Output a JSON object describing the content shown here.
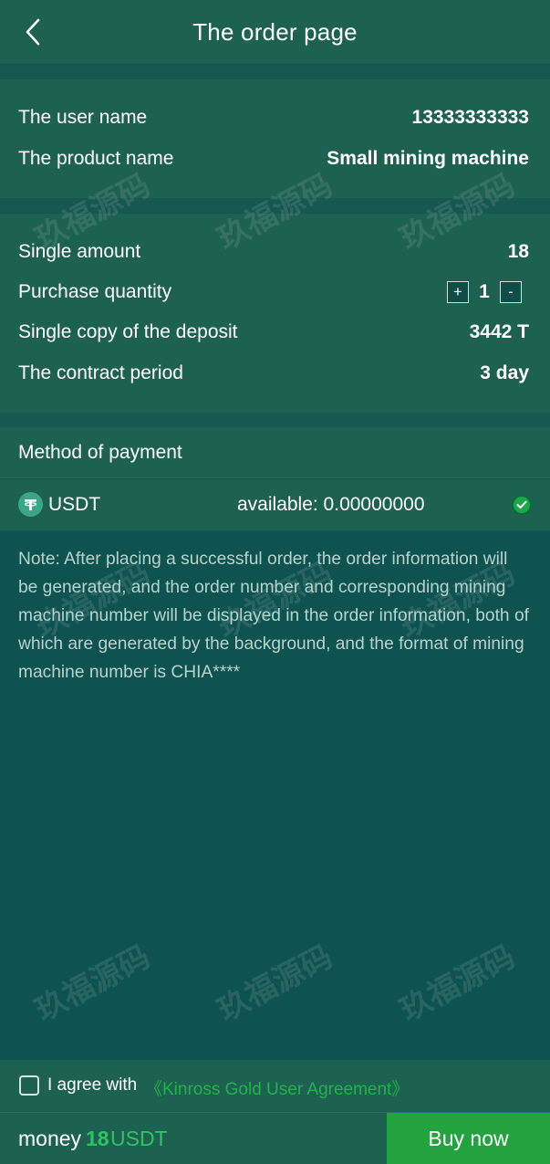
{
  "header": {
    "title": "The order page",
    "back_icon": "chevron-left-icon"
  },
  "user_card": {
    "user_name_label": "The user name",
    "user_name_value": "13333333333",
    "product_name_label": "The product name",
    "product_name_value": "Small mining machine"
  },
  "detail_card": {
    "single_amount_label": "Single amount",
    "single_amount_value": "18",
    "purchase_quantity_label": "Purchase quantity",
    "quantity_plus": "+",
    "quantity_value": "1",
    "quantity_minus": "-",
    "deposit_label": "Single copy of the deposit",
    "deposit_value": "3442 T",
    "contract_label": "The contract period",
    "contract_value": "3 day"
  },
  "payment": {
    "section_title": "Method of payment",
    "method_icon": "tether-icon",
    "method_name": "USDT",
    "available_text": "available: 0.00000000",
    "selected": true
  },
  "note": "Note: After placing a successful order, the order information will be generated, and the order number and corresponding mining machine number will be displayed in the order information, both of which are generated by the background, and the format of mining machine number is CHIA****",
  "watermark": "玖福源码",
  "agreement": {
    "agree_text": "I agree with",
    "link_text": "《Kinross Gold User Agreement》",
    "checked": false
  },
  "footer": {
    "money_label": "money",
    "money_amount": "18",
    "money_unit": "USDT",
    "buy_button": "Buy now"
  },
  "colors": {
    "background": "#0e5350",
    "card": "#1d6150",
    "accent_green": "#22a33f",
    "link_green": "#22b24c",
    "amount_green": "#2ec462"
  }
}
